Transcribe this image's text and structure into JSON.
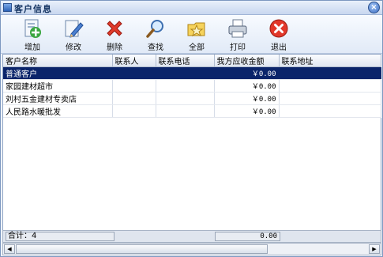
{
  "window": {
    "title": "客户信息"
  },
  "toolbar": {
    "add": "增加",
    "edit": "修改",
    "delete": "删除",
    "search": "查找",
    "all": "全部",
    "print": "打印",
    "exit": "退出"
  },
  "grid": {
    "columns": [
      "客户名称",
      "联系人",
      "联系电话",
      "我方应收金额",
      "联系地址"
    ],
    "rows": [
      {
        "name": "普通客户",
        "contact": "",
        "phone": "",
        "amount": "￥0.00",
        "address": ""
      },
      {
        "name": "家园建材超市",
        "contact": "",
        "phone": "",
        "amount": "￥0.00",
        "address": ""
      },
      {
        "name": "刘村五金建材专卖店",
        "contact": "",
        "phone": "",
        "amount": "￥0.00",
        "address": ""
      },
      {
        "name": "人民路水暖批发",
        "contact": "",
        "phone": "",
        "amount": "￥0.00",
        "address": ""
      }
    ]
  },
  "footer": {
    "count": "合计：4",
    "sum": "0.00"
  },
  "icons": {
    "add": "add-user-icon",
    "edit": "edit-pencil-icon",
    "delete": "delete-x-icon",
    "search": "magnifier-icon",
    "all": "folder-star-icon",
    "print": "printer-icon",
    "exit": "exit-icon"
  }
}
